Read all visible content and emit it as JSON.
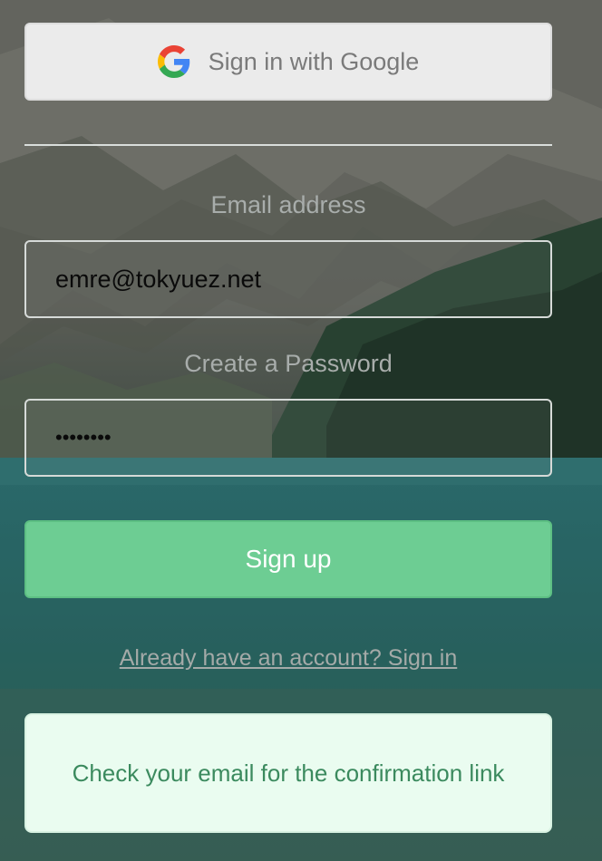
{
  "auth": {
    "google_button_label": "Sign in with Google",
    "email_label": "Email address",
    "email_value": "emre@tokyuez.net",
    "password_label": "Create a Password",
    "password_value": "••••••••",
    "signup_button_label": "Sign up",
    "signin_link_label": "Already have an account? Sign in",
    "confirmation_message": "Check your email for the confirmation link"
  },
  "icons": {
    "google": "google-g-icon"
  },
  "colors": {
    "signup_button": "#6dcd93",
    "message_background": "#eafcf0",
    "message_text": "#3b8a5e",
    "google_button_background": "#ebebeb"
  }
}
